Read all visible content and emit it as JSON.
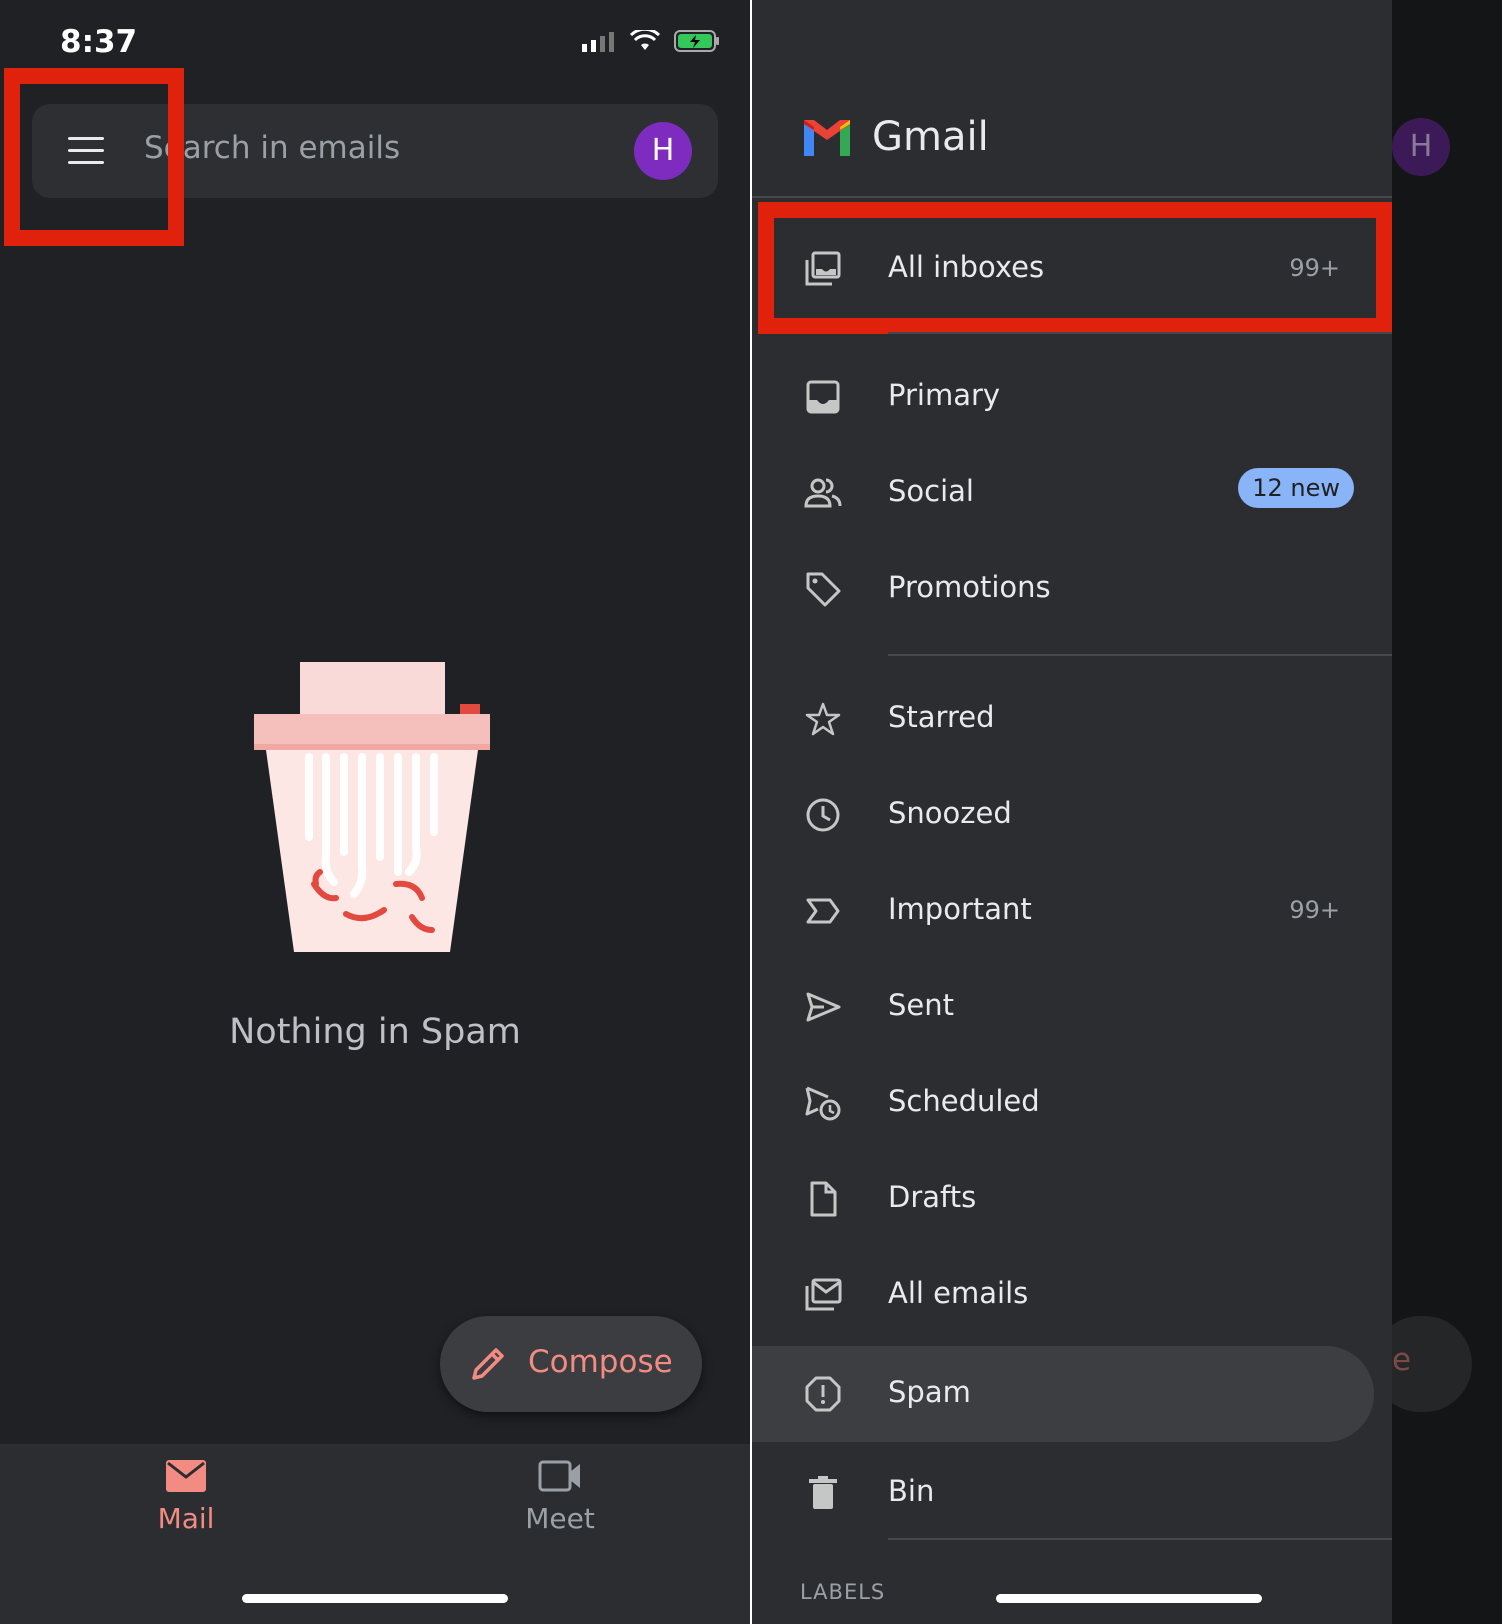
{
  "status": {
    "time": "8:37"
  },
  "search": {
    "placeholder": "Search in emails",
    "avatar_letter": "H"
  },
  "empty_state": {
    "message": "Nothing in Spam"
  },
  "compose": {
    "label": "Compose"
  },
  "bottom_nav": {
    "mail": "Mail",
    "meet": "Meet"
  },
  "drawer": {
    "title": "Gmail",
    "items": [
      {
        "label": "All inboxes",
        "count": "99+",
        "icon": "all-inboxes-icon"
      },
      {
        "label": "Primary",
        "icon": "inbox-icon"
      },
      {
        "label": "Social",
        "badge": "12 new",
        "icon": "people-icon"
      },
      {
        "label": "Promotions",
        "icon": "tag-icon"
      },
      {
        "label": "Starred",
        "icon": "star-icon"
      },
      {
        "label": "Snoozed",
        "icon": "clock-icon"
      },
      {
        "label": "Important",
        "count": "99+",
        "icon": "important-icon"
      },
      {
        "label": "Sent",
        "icon": "send-icon"
      },
      {
        "label": "Scheduled",
        "icon": "scheduled-icon"
      },
      {
        "label": "Drafts",
        "icon": "draft-icon"
      },
      {
        "label": "All emails",
        "icon": "all-mail-icon"
      },
      {
        "label": "Spam",
        "icon": "spam-icon",
        "active": true
      },
      {
        "label": "Bin",
        "icon": "trash-icon"
      }
    ],
    "labels_heading": "LABELS"
  },
  "scrim": {
    "avatar_letter": "H",
    "compose_fragment": "e"
  },
  "colors": {
    "highlight": "#e0210c",
    "accent_red": "#f28b82",
    "badge_blue": "#8ab4f8",
    "avatar_purple": "#7e2bbf"
  }
}
